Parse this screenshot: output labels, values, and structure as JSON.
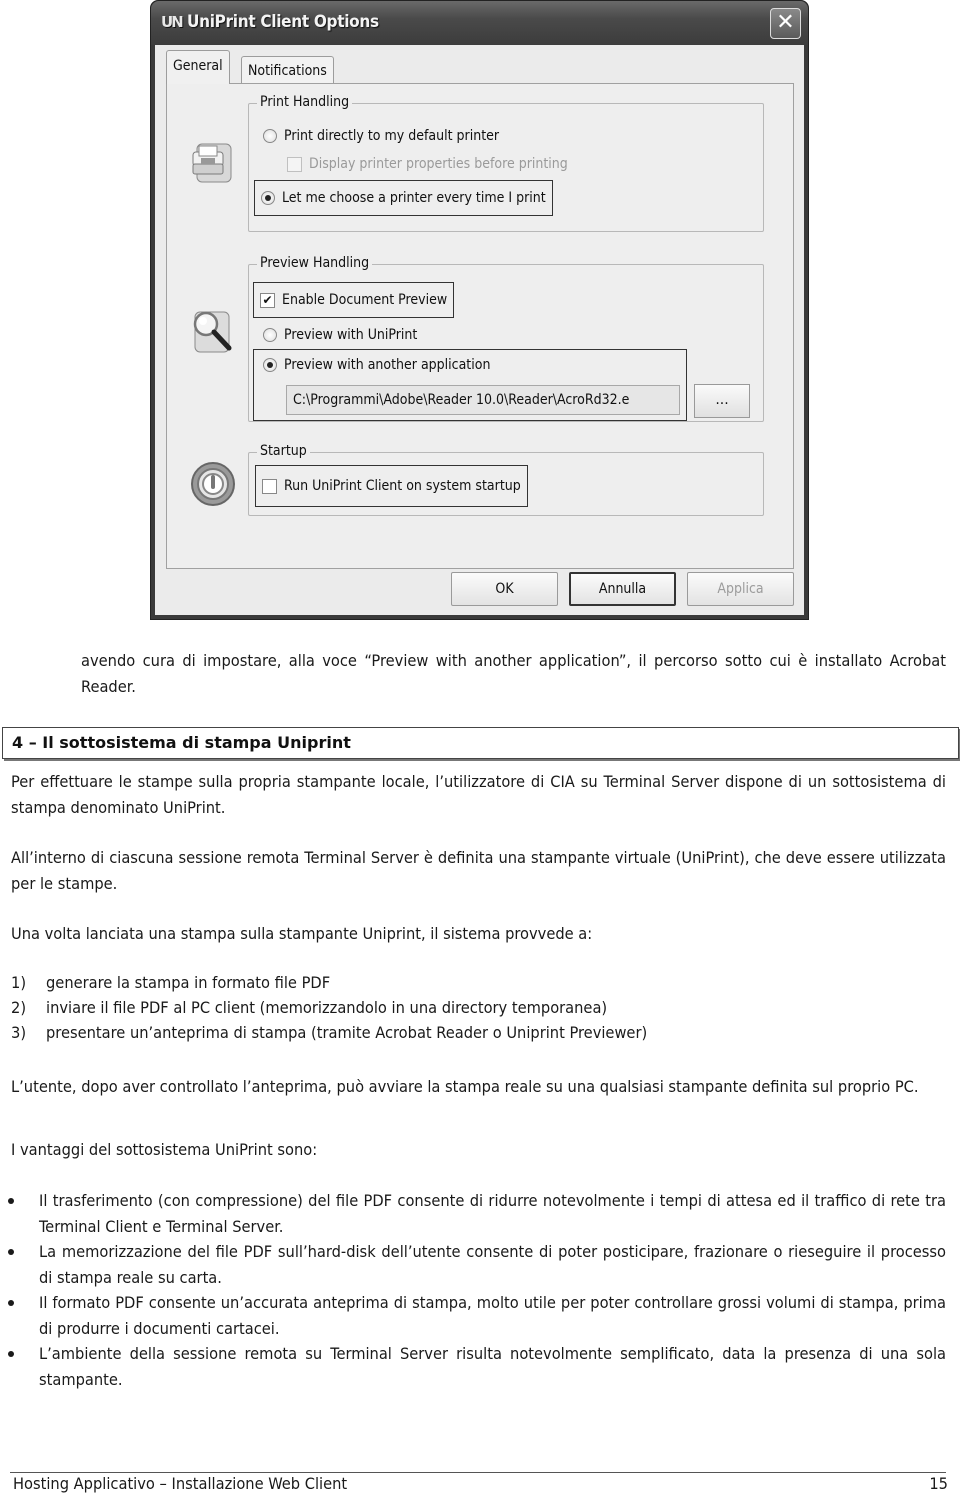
{
  "dialog": {
    "title": "UniPrint Client Options",
    "logo_text": "UN",
    "close_glyph": "✕",
    "tabs": [
      {
        "label": "General",
        "active": true
      },
      {
        "label": "Notifications",
        "active": false
      }
    ],
    "print_handling": {
      "title": "Print Handling",
      "icon": "printer-icon",
      "options": [
        {
          "type": "radio",
          "label": "Print directly to my default printer",
          "checked": false,
          "enabled": true
        },
        {
          "type": "checkbox",
          "label": "Display printer properties before printing",
          "checked": false,
          "enabled": false
        },
        {
          "type": "radio",
          "label": "Let me choose a printer every time I print",
          "checked": true,
          "enabled": true
        }
      ]
    },
    "preview_handling": {
      "title": "Preview Handling",
      "icon": "magnifier-icon",
      "enable_preview": {
        "label": "Enable Document Preview",
        "checked": true,
        "check_glyph": "✔"
      },
      "options": [
        {
          "type": "radio",
          "label": "Preview with UniPrint",
          "checked": false
        },
        {
          "type": "radio",
          "label": "Preview with another application",
          "checked": true
        }
      ],
      "path_value": "C:\\Programmi\\Adobe\\Reader 10.0\\Reader\\AcroRd32.e",
      "browse_label": "..."
    },
    "startup": {
      "title": "Startup",
      "icon": "power-icon",
      "run_on_startup": {
        "label": "Run UniPrint Client on system startup",
        "checked": false
      }
    },
    "buttons": {
      "ok": "OK",
      "cancel": "Annulla",
      "apply": "Applica"
    }
  },
  "document": {
    "intro": "avendo cura di impostare, alla voce “Preview with another application”, il percorso sotto cui è installato Acrobat Reader.",
    "section_heading": "4 – Il sottosistema di stampa Uniprint",
    "paragraphs": [
      "Per effettuare le stampe sulla propria stampante locale, l’utilizzatore di CIA su Terminal Server dispone di un sottosistema di stampa denominato UniPrint.",
      "All’interno di ciascuna sessione remota Terminal Server è definita una stampante virtuale (UniPrint), che deve essere utilizzata per le stampe.",
      "Una volta lanciata una stampa sulla stampante Uniprint, il sistema provvede a:"
    ],
    "steps": [
      {
        "num": "1)",
        "text": "generare la stampa in formato file PDF"
      },
      {
        "num": "2)",
        "text": "inviare il file PDF al PC client (memorizzandolo in una directory temporanea)"
      },
      {
        "num": "3)",
        "text": "presentare un’anteprima di stampa (tramite Acrobat Reader o Uniprint Previewer)"
      }
    ],
    "after_steps": "L’utente, dopo aver controllato l’anteprima, può avviare la stampa reale su una qualsiasi stampante definita sul proprio PC.",
    "advantages_intro": "I vantaggi del sottosistema UniPrint sono:",
    "advantages": [
      "Il trasferimento (con compressione) del file PDF consente di ridurre notevolmente i tempi di attesa ed il traffico di rete tra Terminal Client e Terminal Server.",
      "La memorizzazione del file PDF sull’hard-disk dell’utente consente di poter posticipare, frazionare o rieseguire il processo di stampa reale su carta.",
      "Il formato PDF consente un’accurata anteprima di stampa, molto utile per poter controllare grossi volumi di stampa, prima di produrre i documenti cartacei.",
      "L’ambiente della sessione remota su Terminal Server risulta notevolmente semplificato, data la presenza di una sola stampante."
    ]
  },
  "footer": {
    "title": "Hosting Applicativo – Installazione Web Client",
    "page_number": "15"
  }
}
